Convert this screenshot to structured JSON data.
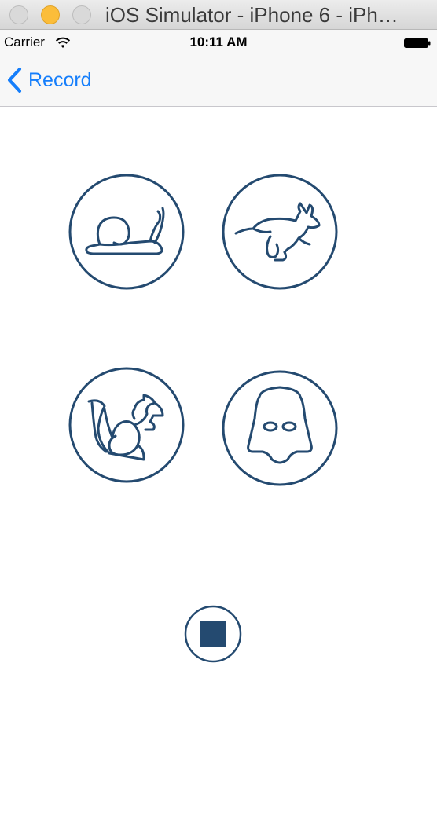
{
  "window": {
    "title": "iOS Simulator - iPhone 6 - iPh…"
  },
  "status_bar": {
    "carrier": "Carrier",
    "time": "10:11 AM"
  },
  "nav": {
    "back_label": "Record"
  },
  "effects": [
    {
      "name": "slow",
      "icon": "snail-icon"
    },
    {
      "name": "fast",
      "icon": "rabbit-icon"
    },
    {
      "name": "chipmunk",
      "icon": "squirrel-icon"
    },
    {
      "name": "vader",
      "icon": "darth-vader-helmet-icon"
    }
  ],
  "stop": {
    "icon": "stop-icon"
  },
  "colors": {
    "accent": "#157efb",
    "icon_stroke": "#244a70"
  }
}
